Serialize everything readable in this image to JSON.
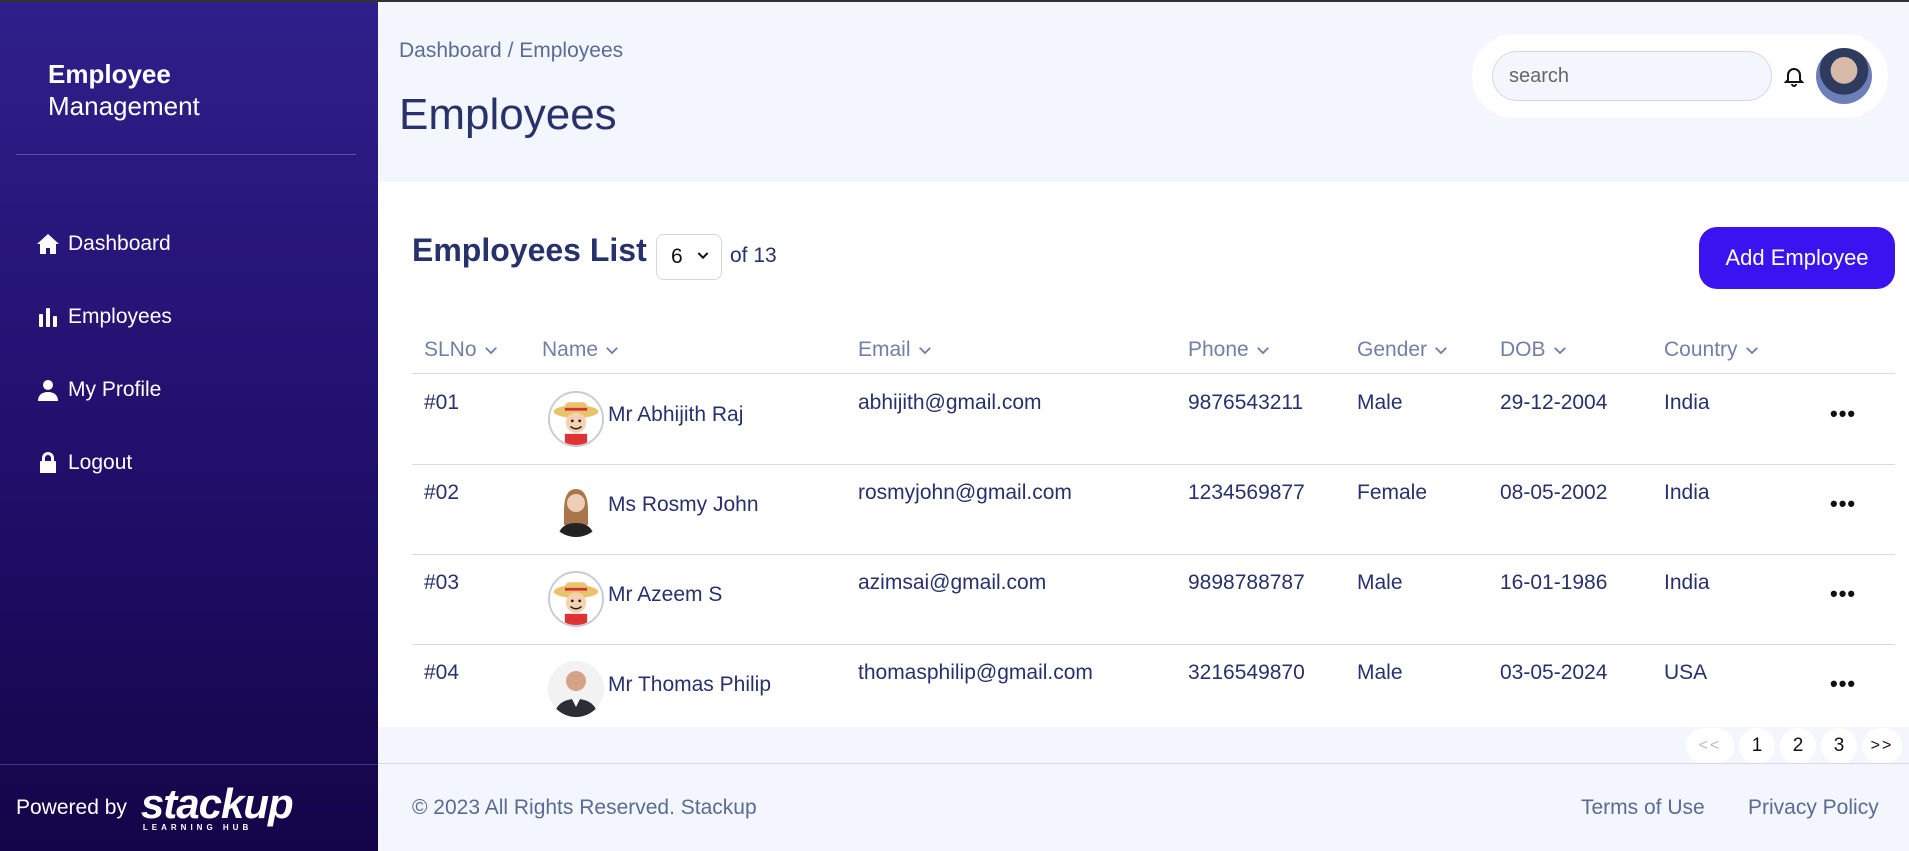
{
  "sidebar": {
    "brand_line1": "Employee",
    "brand_line2": "Management",
    "items": [
      {
        "label": "Dashboard",
        "icon": "home-icon"
      },
      {
        "label": "Employees",
        "icon": "bar-chart-icon"
      },
      {
        "label": "My Profile",
        "icon": "user-icon"
      },
      {
        "label": "Logout",
        "icon": "lock-icon"
      }
    ],
    "powered_by": "Powered by",
    "logo_text": "stackup",
    "logo_sub": "LEARNING HUB"
  },
  "header": {
    "breadcrumb": "Dashboard / Employees",
    "title": "Employees",
    "search_placeholder": "search"
  },
  "list": {
    "title": "Employees List",
    "page_size": "6",
    "of_total": "of 13",
    "add_button": "Add Employee",
    "columns": [
      "SLNo",
      "Name",
      "Email",
      "Phone",
      "Gender",
      "DOB",
      "Country"
    ],
    "rows": [
      {
        "sl": "#01",
        "name": "Mr Abhijith Raj",
        "email": "abhijith@gmail.com",
        "phone": "9876543211",
        "gender": "Male",
        "dob": "29-12-2004",
        "country": "India",
        "avatar": "cartoon"
      },
      {
        "sl": "#02",
        "name": "Ms Rosmy John",
        "email": "rosmyjohn@gmail.com",
        "phone": "1234569877",
        "gender": "Female",
        "dob": "08-05-2002",
        "country": "India",
        "avatar": "woman"
      },
      {
        "sl": "#03",
        "name": "Mr Azeem S",
        "email": "azimsai@gmail.com",
        "phone": "9898788787",
        "gender": "Male",
        "dob": "16-01-1986",
        "country": "India",
        "avatar": "cartoon"
      },
      {
        "sl": "#04",
        "name": "Mr Thomas Philip",
        "email": "thomasphilip@gmail.com",
        "phone": "3216549870",
        "gender": "Male",
        "dob": "03-05-2024",
        "country": "USA",
        "avatar": "man"
      }
    ],
    "more_label": "•••"
  },
  "pagination": {
    "prev": "<<",
    "pages": [
      "1",
      "2",
      "3"
    ],
    "next": ">>"
  },
  "footer": {
    "copyright": "© 2023 All Rights Reserved. Stackup",
    "terms": "Terms of Use",
    "privacy": "Privacy Policy"
  },
  "colors": {
    "accent": "#3a14f0",
    "text": "#27316b",
    "sidebar_top": "#2f1f8a",
    "sidebar_bottom": "#130548"
  }
}
